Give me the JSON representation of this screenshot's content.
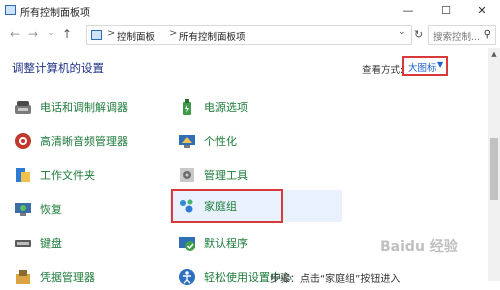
{
  "window": {
    "title": "所有控制面板项",
    "min": "—",
    "max": "☐",
    "close": "✕"
  },
  "nav": {
    "back": "←",
    "forward": "→",
    "down": "⌄",
    "up": "↑",
    "crumbs": [
      "控制面板",
      "所有控制面板项"
    ],
    "separator": ">",
    "search_placeholder": "搜索控制..."
  },
  "header": {
    "heading": "调整计算机的设置",
    "view_by_label": "查看方式:",
    "view_by_value": "大图标"
  },
  "items_left": [
    {
      "label": "电话和调制解调器",
      "icon": "phone-modem-icon"
    },
    {
      "label": "高清晰音频管理器",
      "icon": "audio-manager-icon"
    },
    {
      "label": "工作文件夹",
      "icon": "work-folders-icon"
    },
    {
      "label": "恢复",
      "icon": "recovery-icon"
    },
    {
      "label": "键盘",
      "icon": "keyboard-icon"
    },
    {
      "label": "凭据管理器",
      "icon": "credential-manager-icon"
    }
  ],
  "items_right": [
    {
      "label": "电源选项",
      "icon": "power-options-icon"
    },
    {
      "label": "个性化",
      "icon": "personalization-icon"
    },
    {
      "label": "管理工具",
      "icon": "admin-tools-icon"
    },
    {
      "label": "家庭组",
      "icon": "homegroup-icon"
    },
    {
      "label": "默认程序",
      "icon": "default-programs-icon"
    },
    {
      "label": "轻松使用设置中心",
      "icon": "ease-of-access-icon"
    }
  ],
  "bottom_overlay": "步骤：点击“家庭组”按钮进入",
  "watermark": "Baidu 经验",
  "colors": {
    "link": "#1e7b3b",
    "heading": "#1e3287",
    "highlight": "#e9f2fc",
    "annotation": "#d83a3a"
  }
}
